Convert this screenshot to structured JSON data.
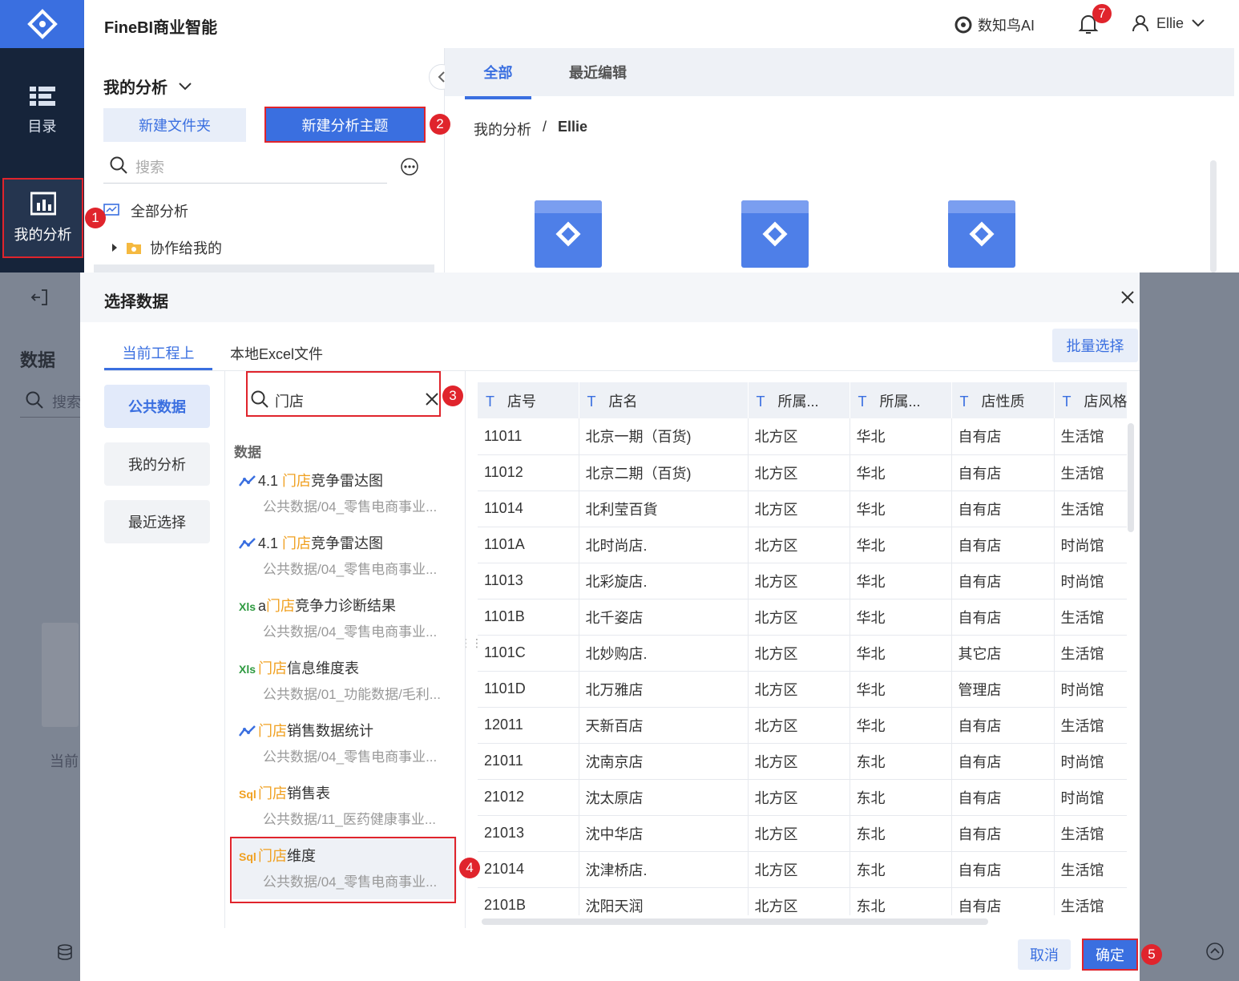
{
  "app": {
    "title": "FineBI商业智能",
    "ai_label": "数知鸟AI",
    "notif_count": "7",
    "user": "Ellie"
  },
  "nav": {
    "catalog": "目录",
    "my_analysis": "我的分析"
  },
  "left": {
    "heading": "我的分析",
    "new_folder": "新建文件夹",
    "new_subject": "新建分析主题",
    "search_placeholder": "搜索",
    "all_analysis": "全部分析",
    "shared": "协作给我的"
  },
  "right": {
    "tabs": [
      "全部",
      "最近编辑"
    ],
    "crumb_root": "我的分析",
    "crumb_sep": "/",
    "crumb_current": "Ellie"
  },
  "behind": {
    "data_title": "数据",
    "search_placeholder": "搜索",
    "current_label": "当前"
  },
  "dialog": {
    "title": "选择数据",
    "tabs": [
      "当前工程上",
      "本地Excel文件"
    ],
    "batch_select": "批量选择",
    "side": [
      "公共数据",
      "我的分析",
      "最近选择"
    ],
    "search_value": "门店",
    "section": "数据",
    "cancel": "取消",
    "confirm": "确定",
    "results": [
      {
        "icon": "line-chart-icon",
        "pre": "4.1 ",
        "hl": "门店",
        "post": "竞争雷达图",
        "path": "公共数据/04_零售电商事业..."
      },
      {
        "icon": "line-chart-icon",
        "pre": "4.1 ",
        "hl": "门店",
        "post": "竞争雷达图",
        "path": "公共数据/04_零售电商事业..."
      },
      {
        "icon": "xls-icon",
        "pre": "a",
        "hl": "门店",
        "post": "竞争力诊断结果",
        "path": "公共数据/04_零售电商事业..."
      },
      {
        "icon": "xls-icon",
        "pre": "",
        "hl": "门店",
        "post": "信息维度表",
        "path": "公共数据/01_功能数据/毛利..."
      },
      {
        "icon": "line-chart-icon",
        "pre": "",
        "hl": "门店",
        "post": "销售数据统计",
        "path": "公共数据/04_零售电商事业..."
      },
      {
        "icon": "sql-icon",
        "pre": "",
        "hl": "门店",
        "post": "销售表",
        "path": "公共数据/11_医药健康事业..."
      },
      {
        "icon": "sql-icon",
        "pre": "",
        "hl": "门店",
        "post": "维度",
        "path": "公共数据/04_零售电商事业..."
      }
    ],
    "columns": [
      "店号",
      "店名",
      "所属...",
      "所属...",
      "店性质",
      "店风格"
    ],
    "rows": [
      [
        "11011",
        "北京一期（百货)",
        "北方区",
        "华北",
        "自有店",
        "生活馆"
      ],
      [
        "11012",
        "北京二期（百货)",
        "北方区",
        "华北",
        "自有店",
        "生活馆"
      ],
      [
        "11014",
        "北利莹百貨",
        "北方区",
        "华北",
        "自有店",
        "生活馆"
      ],
      [
        "1101A",
        "北时尚店.",
        "北方区",
        "华北",
        "自有店",
        "时尚馆"
      ],
      [
        "11013",
        "北彩旋店.",
        "北方区",
        "华北",
        "自有店",
        "时尚馆"
      ],
      [
        "1101B",
        "北千姿店",
        "北方区",
        "华北",
        "自有店",
        "生活馆"
      ],
      [
        "1101C",
        "北妙购店.",
        "北方区",
        "华北",
        "其它店",
        "生活馆"
      ],
      [
        "1101D",
        "北万雅店",
        "北方区",
        "华北",
        "管理店",
        "时尚馆"
      ],
      [
        "12011",
        "天新百店",
        "北方区",
        "华北",
        "自有店",
        "生活馆"
      ],
      [
        "21011",
        "沈南京店",
        "北方区",
        "东北",
        "自有店",
        "时尚馆"
      ],
      [
        "21012",
        "沈太原店",
        "北方区",
        "东北",
        "自有店",
        "时尚馆"
      ],
      [
        "21013",
        "沈中华店",
        "北方区",
        "东北",
        "自有店",
        "生活馆"
      ],
      [
        "21014",
        "沈津桥店.",
        "北方区",
        "东北",
        "自有店",
        "生活馆"
      ],
      [
        "2101B",
        "沈阳天润",
        "北方区",
        "东北",
        "自有店",
        "生活馆"
      ]
    ]
  },
  "steps": [
    "1",
    "2",
    "3",
    "4",
    "5"
  ],
  "colors": {
    "accent": "#3a6fe0",
    "red": "#e0242c",
    "highlight": "#f0a020",
    "nav_bg": "#16243a"
  }
}
